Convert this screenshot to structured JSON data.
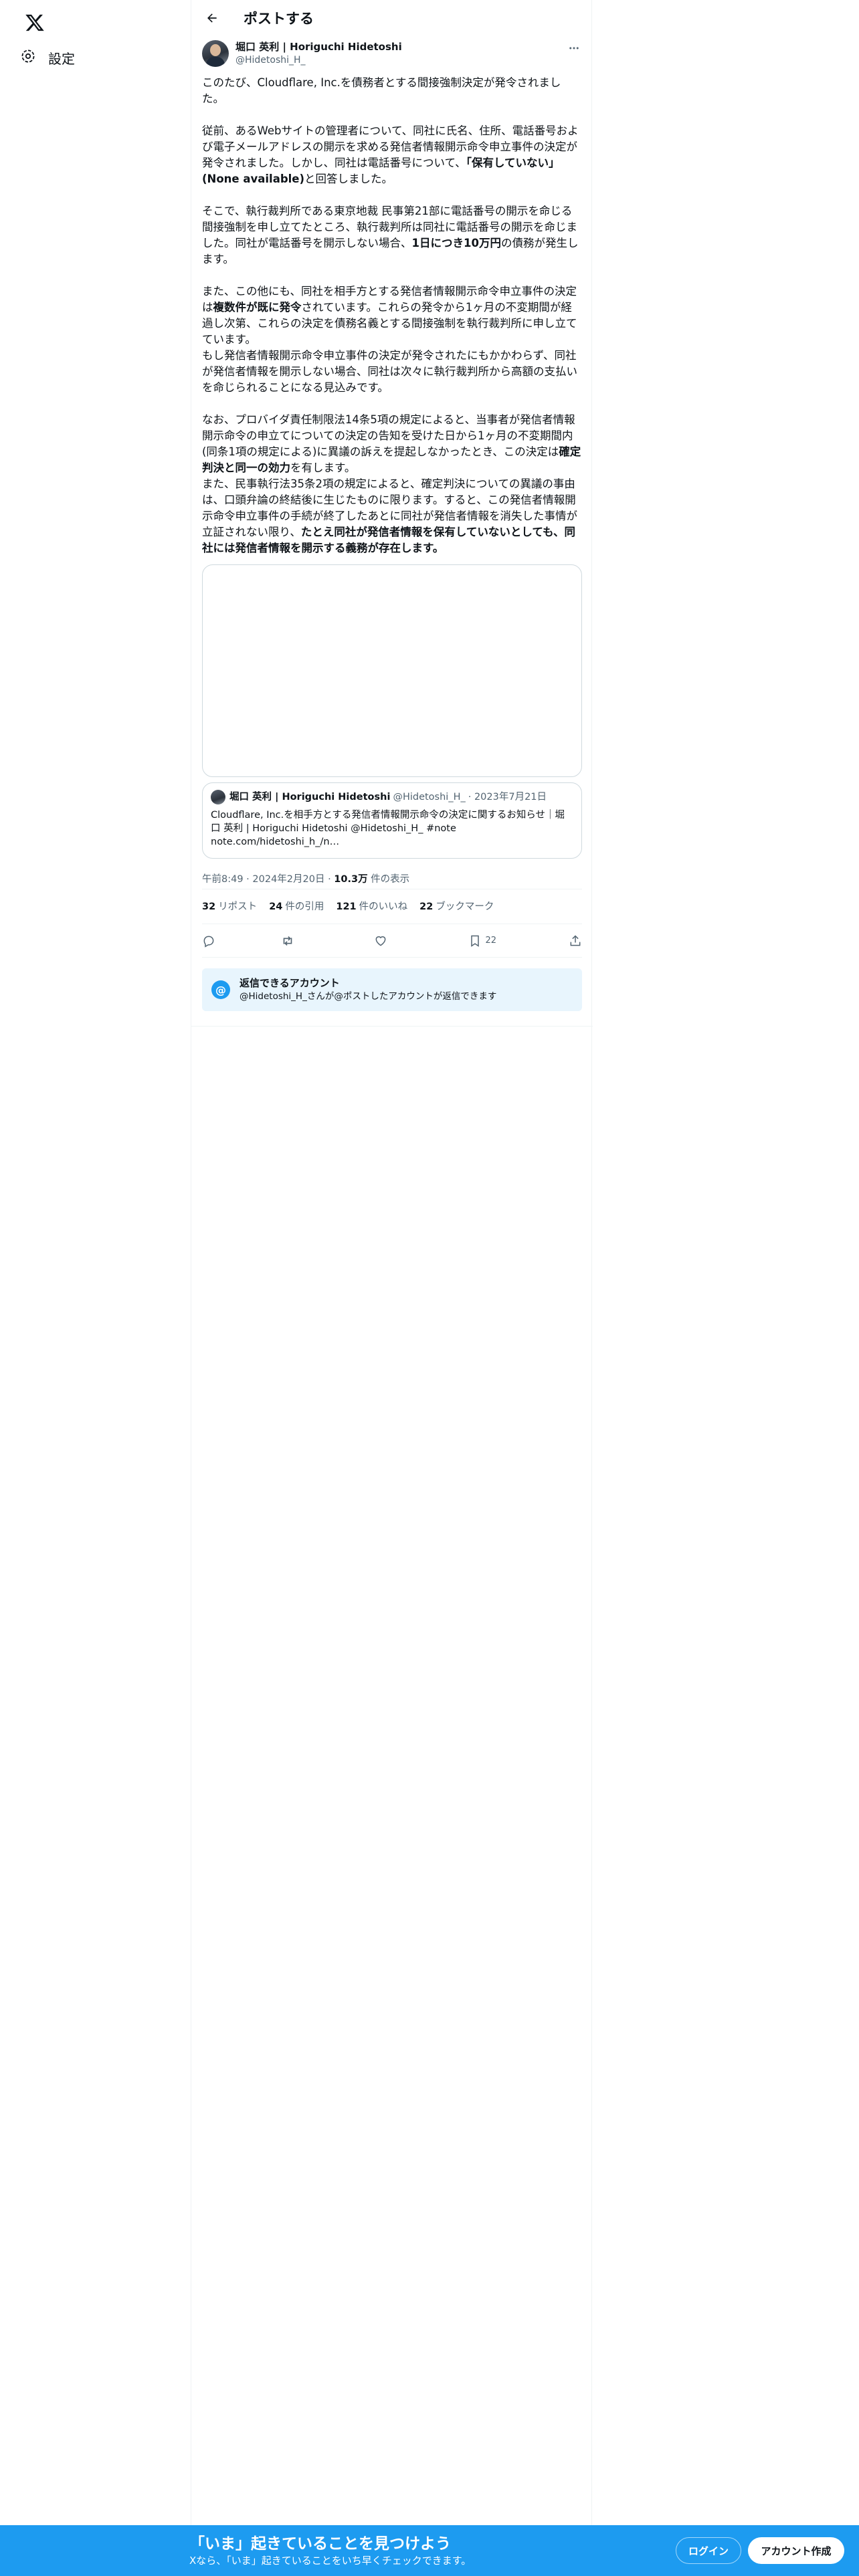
{
  "sidebar": {
    "logo_icon": "x-logo-icon",
    "settings_label": "設定"
  },
  "header": {
    "title": "ポストする"
  },
  "post": {
    "author_name": "堀口 英利 | Horiguchi Hidetoshi",
    "author_handle": "@Hidetoshi_H_",
    "paragraphs": {
      "p1": "このたび、Cloudflare, Inc.を債務者とする間接強制決定が発令されました。",
      "p2a": "従前、あるWebサイトの管理者について、同社に氏名、住所、電話番号および電子メールアドレスの開示を求める発信者情報開示命令申立事件の決定が発令されました。しかし、同社は電話番号について、",
      "p2b": "「保有していない」(None available)",
      "p2c": "と回答しました。",
      "p3a": "そこで、執行裁判所である東京地裁 民事第21部に電話番号の開示を命じる間接強制を申し立てたところ、執行裁判所は同社に電話番号の開示を命じました。同社が電話番号を開示しない場合、",
      "p3b": "1日につき10万円",
      "p3c": "の債務が発生します。",
      "p4a": "また、この他にも、同社を相手方とする発信者情報開示命令申立事件の決定は",
      "p4b": "複数件が既に発令",
      "p4c": "されています。これらの発令から1ヶ月の不変期間が経過し次第、これらの決定を債務名義とする間接強制を執行裁判所に申し立てています。",
      "p5": "もし発信者情報開示命令申立事件の決定が発令されたにもかかわらず、同社が発信者情報を開示しない場合、同社は次々に執行裁判所から高額の支払いを命じられることになる見込みです。",
      "p6a": "なお、プロバイダ責任制限法14条5項の規定によると、当事者が発信者情報開示命令の申立てについての決定の告知を受けた日から1ヶ月の不変期間内(同条1項の規定による)に異議の訴えを提起しなかったとき、この決定は",
      "p6b": "確定判決と同一の効力",
      "p6c": "を有します。",
      "p7a": "また、民事執行法35条2項の規定によると、確定判決についての異議の事由は、口頭弁論の終結後に生じたものに限ります。すると、この発信者情報開示命令申立事件の手続が終了したあとに同社が発信者情報を消失した事情が立証されない限り、",
      "p7b": "たとえ同社が発信者情報を保有していないとしても、同社には発信者情報を開示する義務が存在します。"
    },
    "quote": {
      "name": "堀口 英利 | Horiguchi Hidetoshi",
      "handle": "@Hidetoshi_H_",
      "date": "· 2023年7月21日",
      "text": "Cloudflare, Inc.を相手方とする発信者情報開示命令の決定に関するお知らせ｜堀口 英利 | Horiguchi Hidetoshi @Hidetoshi_H_ #note note.com/hidetoshi_h_/n…"
    },
    "meta": {
      "time": "午前8:49 · 2024年2月20日 · ",
      "views_count": "10.3万",
      "views_label": " 件の表示"
    },
    "stats": {
      "reposts_count": "32",
      "reposts_label": "リポスト",
      "quotes_count": "24",
      "quotes_label": "件の引用",
      "likes_count": "121",
      "likes_label": "件のいいね",
      "bookmarks_count": "22",
      "bookmarks_label": "ブックマーク"
    },
    "actions": {
      "bookmark_count": "22"
    },
    "reply_notice": {
      "title": "返信できるアカウント",
      "subtitle": "@Hidetoshi_H_さんが@ポストしたアカウントが返信できます",
      "icon_text": "@"
    }
  },
  "banner": {
    "title": "「いま」起きていることを見つけよう",
    "subtitle": "Xなら、「いま」起きていることをいち早くチェックできます。",
    "login_label": "ログイン",
    "signup_label": "アカウント作成"
  },
  "colors": {
    "accent": "#1d9bf0",
    "text": "#0f1419",
    "muted": "#536471",
    "border": "#cfd9de"
  }
}
